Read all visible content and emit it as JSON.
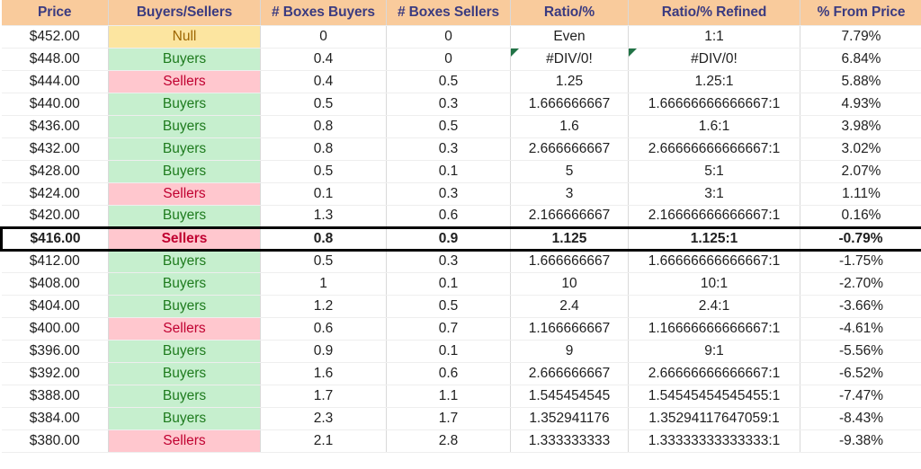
{
  "table": {
    "columns": [
      {
        "key": "price",
        "label": "Price"
      },
      {
        "key": "bs",
        "label": "Buyers/Sellers"
      },
      {
        "key": "bb",
        "label": "# Boxes Buyers"
      },
      {
        "key": "bsl",
        "label": "# Boxes Sellers"
      },
      {
        "key": "ratio",
        "label": "Ratio/%"
      },
      {
        "key": "refined",
        "label": "Ratio/% Refined"
      },
      {
        "key": "pct",
        "label": "% From Price"
      }
    ],
    "colors": {
      "header_bg": "#F9CB9C",
      "header_text": "#3B3B80",
      "buyers_bg": "#C6EFCE",
      "buyers_text": "#1E7B1E",
      "sellers_bg": "#FFC7CE",
      "sellers_text": "#C00030",
      "null_bg": "#FCE5A0",
      "null_text": "#9C6500",
      "highlight_border": "#000000",
      "error_marker": "#217346"
    },
    "rows": [
      {
        "price": "$452.00",
        "bs": "Null",
        "signal": "null",
        "bb": "0",
        "bsl": "0",
        "ratio": "Even",
        "refined": "1:1",
        "pct": "7.79%",
        "error": false,
        "highlight": false
      },
      {
        "price": "$448.00",
        "bs": "Buyers",
        "signal": "buyers",
        "bb": "0.4",
        "bsl": "0",
        "ratio": "#DIV/0!",
        "refined": "#DIV/0!",
        "pct": "6.84%",
        "error": true,
        "highlight": false
      },
      {
        "price": "$444.00",
        "bs": "Sellers",
        "signal": "sellers",
        "bb": "0.4",
        "bsl": "0.5",
        "ratio": "1.25",
        "refined": "1.25:1",
        "pct": "5.88%",
        "error": false,
        "highlight": false
      },
      {
        "price": "$440.00",
        "bs": "Buyers",
        "signal": "buyers",
        "bb": "0.5",
        "bsl": "0.3",
        "ratio": "1.666666667",
        "refined": "1.66666666666667:1",
        "pct": "4.93%",
        "error": false,
        "highlight": false
      },
      {
        "price": "$436.00",
        "bs": "Buyers",
        "signal": "buyers",
        "bb": "0.8",
        "bsl": "0.5",
        "ratio": "1.6",
        "refined": "1.6:1",
        "pct": "3.98%",
        "error": false,
        "highlight": false
      },
      {
        "price": "$432.00",
        "bs": "Buyers",
        "signal": "buyers",
        "bb": "0.8",
        "bsl": "0.3",
        "ratio": "2.666666667",
        "refined": "2.66666666666667:1",
        "pct": "3.02%",
        "error": false,
        "highlight": false
      },
      {
        "price": "$428.00",
        "bs": "Buyers",
        "signal": "buyers",
        "bb": "0.5",
        "bsl": "0.1",
        "ratio": "5",
        "refined": "5:1",
        "pct": "2.07%",
        "error": false,
        "highlight": false
      },
      {
        "price": "$424.00",
        "bs": "Sellers",
        "signal": "sellers",
        "bb": "0.1",
        "bsl": "0.3",
        "ratio": "3",
        "refined": "3:1",
        "pct": "1.11%",
        "error": false,
        "highlight": false
      },
      {
        "price": "$420.00",
        "bs": "Buyers",
        "signal": "buyers",
        "bb": "1.3",
        "bsl": "0.6",
        "ratio": "2.166666667",
        "refined": "2.16666666666667:1",
        "pct": "0.16%",
        "error": false,
        "highlight": false
      },
      {
        "price": "$416.00",
        "bs": "Sellers",
        "signal": "sellers",
        "bb": "0.8",
        "bsl": "0.9",
        "ratio": "1.125",
        "refined": "1.125:1",
        "pct": "-0.79%",
        "error": false,
        "highlight": true
      },
      {
        "price": "$412.00",
        "bs": "Buyers",
        "signal": "buyers",
        "bb": "0.5",
        "bsl": "0.3",
        "ratio": "1.666666667",
        "refined": "1.66666666666667:1",
        "pct": "-1.75%",
        "error": false,
        "highlight": false
      },
      {
        "price": "$408.00",
        "bs": "Buyers",
        "signal": "buyers",
        "bb": "1",
        "bsl": "0.1",
        "ratio": "10",
        "refined": "10:1",
        "pct": "-2.70%",
        "error": false,
        "highlight": false
      },
      {
        "price": "$404.00",
        "bs": "Buyers",
        "signal": "buyers",
        "bb": "1.2",
        "bsl": "0.5",
        "ratio": "2.4",
        "refined": "2.4:1",
        "pct": "-3.66%",
        "error": false,
        "highlight": false
      },
      {
        "price": "$400.00",
        "bs": "Sellers",
        "signal": "sellers",
        "bb": "0.6",
        "bsl": "0.7",
        "ratio": "1.166666667",
        "refined": "1.16666666666667:1",
        "pct": "-4.61%",
        "error": false,
        "highlight": false
      },
      {
        "price": "$396.00",
        "bs": "Buyers",
        "signal": "buyers",
        "bb": "0.9",
        "bsl": "0.1",
        "ratio": "9",
        "refined": "9:1",
        "pct": "-5.56%",
        "error": false,
        "highlight": false
      },
      {
        "price": "$392.00",
        "bs": "Buyers",
        "signal": "buyers",
        "bb": "1.6",
        "bsl": "0.6",
        "ratio": "2.666666667",
        "refined": "2.66666666666667:1",
        "pct": "-6.52%",
        "error": false,
        "highlight": false
      },
      {
        "price": "$388.00",
        "bs": "Buyers",
        "signal": "buyers",
        "bb": "1.7",
        "bsl": "1.1",
        "ratio": "1.545454545",
        "refined": "1.54545454545455:1",
        "pct": "-7.47%",
        "error": false,
        "highlight": false
      },
      {
        "price": "$384.00",
        "bs": "Buyers",
        "signal": "buyers",
        "bb": "2.3",
        "bsl": "1.7",
        "ratio": "1.352941176",
        "refined": "1.35294117647059:1",
        "pct": "-8.43%",
        "error": false,
        "highlight": false
      },
      {
        "price": "$380.00",
        "bs": "Sellers",
        "signal": "sellers",
        "bb": "2.1",
        "bsl": "2.8",
        "ratio": "1.333333333",
        "refined": "1.33333333333333:1",
        "pct": "-9.38%",
        "error": false,
        "highlight": false
      }
    ]
  }
}
